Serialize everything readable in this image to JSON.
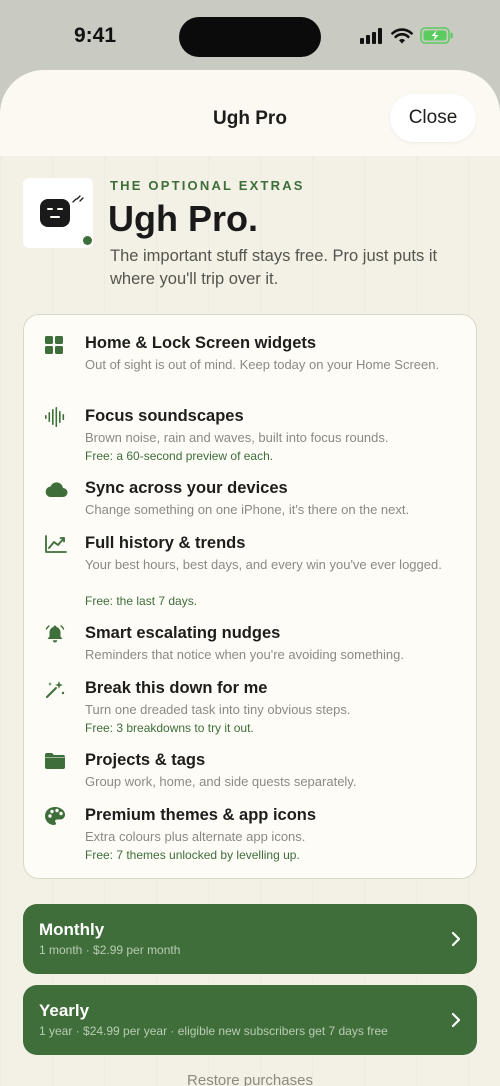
{
  "status": {
    "time": "9:41"
  },
  "nav": {
    "title": "Ugh Pro",
    "close_label": "Close"
  },
  "hero": {
    "eyebrow": "THE OPTIONAL EXTRAS",
    "title": "Ugh Pro.",
    "subtitle": "The important stuff stays free. Pro just puts it where you'll trip over it."
  },
  "features": [
    {
      "icon": "widgets-icon",
      "title": "Home & Lock Screen widgets",
      "desc": "Out of sight is out of mind. Keep today on your Home Screen.",
      "free": ""
    },
    {
      "icon": "waveform-icon",
      "title": "Focus soundscapes",
      "desc": "Brown noise, rain and waves, built into focus rounds.",
      "free": "Free: a 60-second preview of each."
    },
    {
      "icon": "cloud-icon",
      "title": "Sync across your devices",
      "desc": "Change something on one iPhone, it's there on the next.",
      "free": ""
    },
    {
      "icon": "chart-icon",
      "title": "Full history & trends",
      "desc": "Your best hours, best days, and every win you've ever logged.",
      "free": "Free: the last 7 days."
    },
    {
      "icon": "bell-icon",
      "title": "Smart escalating nudges",
      "desc": "Reminders that notice when you're avoiding something.",
      "free": ""
    },
    {
      "icon": "magic-wand-icon",
      "title": "Break this down for me",
      "desc": "Turn one dreaded task into tiny obvious steps.",
      "free": "Free: 3 breakdowns to try it out."
    },
    {
      "icon": "folder-icon",
      "title": "Projects & tags",
      "desc": "Group work, home, and side quests separately.",
      "free": ""
    },
    {
      "icon": "palette-icon",
      "title": "Premium themes & app icons",
      "desc": "Extra colours plus alternate app icons.",
      "free": "Free: 7 themes unlocked by levelling up."
    }
  ],
  "plans": [
    {
      "title": "Monthly",
      "detail": "1 month · $2.99 per month"
    },
    {
      "title": "Yearly",
      "detail": "1 year · $24.99 per year · eligible new subscribers get 7 days free"
    }
  ],
  "footer": {
    "restore_label": "Restore purchases"
  },
  "colors": {
    "accent": "#3e6e3a",
    "background": "#f3f0e6",
    "card": "#fdfcf7",
    "battery": "#5ccb5f"
  }
}
